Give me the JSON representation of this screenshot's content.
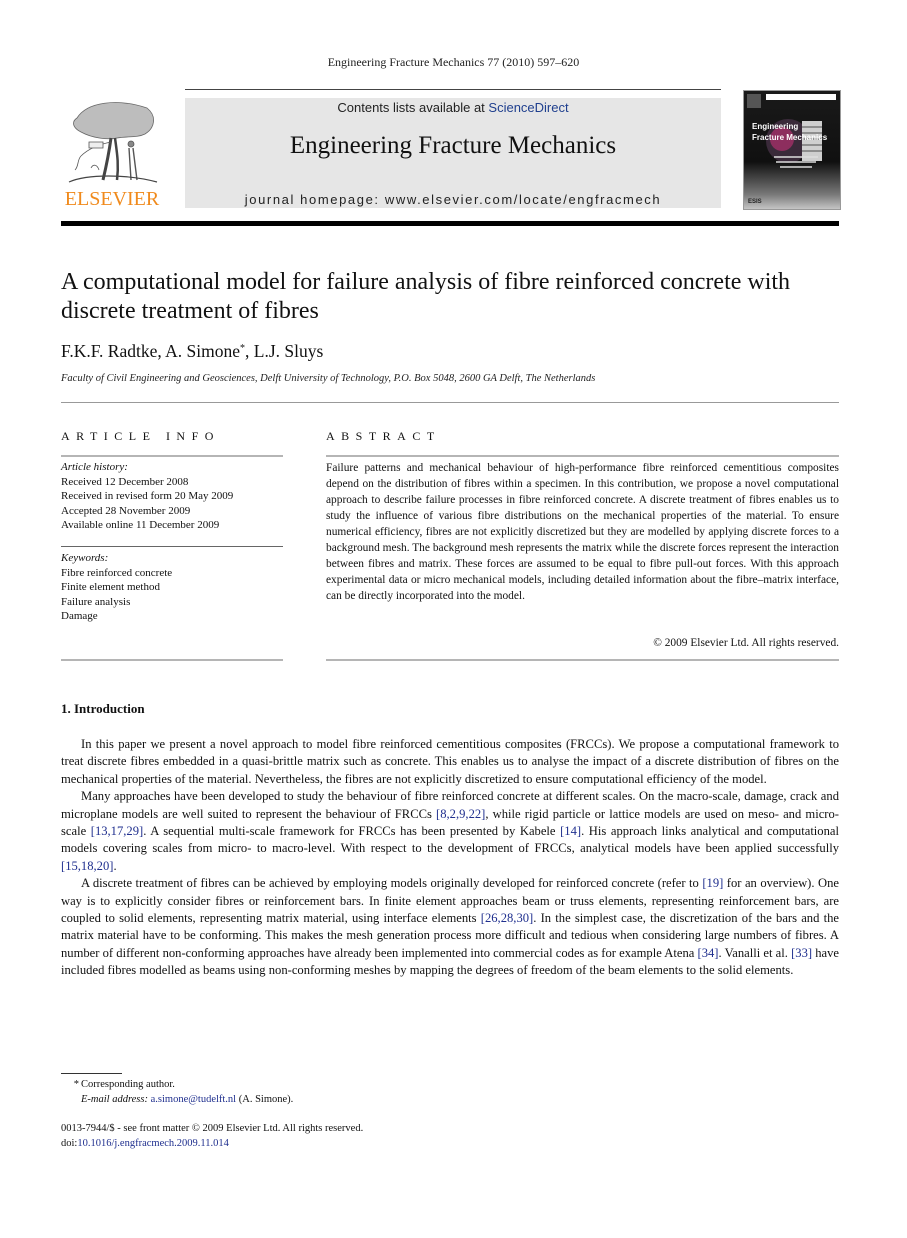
{
  "running_head": "Engineering Fracture Mechanics 77 (2010) 597–620",
  "publisher": {
    "logo_wordmark": "ELSEVIER",
    "brand_color": "#f08a1c"
  },
  "banner": {
    "contents_prefix": "Contents lists available at ",
    "contents_link": "ScienceDirect",
    "journal_title": "Engineering Fracture Mechanics",
    "homepage": "journal homepage: www.elsevier.com/locate/engfracmech",
    "link_color": "#1f3f8e"
  },
  "cover": {
    "title_line1": "Engineering",
    "title_line2": "Fracture Mechanics",
    "footer": "ESIS"
  },
  "article": {
    "title": "A computational model for failure analysis of fibre reinforced concrete with discrete treatment of fibres",
    "authors": [
      {
        "name": "F.K.F. Radtke",
        "mark": ""
      },
      {
        "name": "A. Simone",
        "mark": "*"
      },
      {
        "name": "L.J. Sluys",
        "mark": ""
      }
    ],
    "affiliation": "Faculty of Civil Engineering and Geosciences, Delft University of Technology, P.O. Box 5048, 2600 GA Delft, The Netherlands"
  },
  "article_info": {
    "heading": "ARTICLE INFO",
    "history_label": "Article history:",
    "history": [
      "Received 12 December 2008",
      "Received in revised form 20 May 2009",
      "Accepted 28 November 2009",
      "Available online 11 December 2009"
    ],
    "keywords_label": "Keywords:",
    "keywords": [
      "Fibre reinforced concrete",
      "Finite element method",
      "Failure analysis",
      "Damage"
    ]
  },
  "abstract": {
    "heading": "ABSTRACT",
    "text": "Failure patterns and mechanical behaviour of high-performance fibre reinforced cementitious composites depend on the distribution of fibres within a specimen. In this contribution, we propose a novel computational approach to describe failure processes in fibre reinforced concrete. A discrete treatment of fibres enables us to study the influence of various fibre distributions on the mechanical properties of the material. To ensure numerical efficiency, fibres are not explicitly discretized but they are modelled by applying discrete forces to a background mesh. The background mesh represents the matrix while the discrete forces represent the interaction between fibres and matrix. These forces are assumed to be equal to fibre pull-out forces. With this approach experimental data or micro mechanical models, including detailed information about the fibre–matrix interface, can be directly incorporated into the model.",
    "copyright": "© 2009 Elsevier Ltd. All rights reserved."
  },
  "introduction": {
    "heading": "1.  Introduction",
    "paragraphs": [
      [
        {
          "t": "In this paper we present a novel approach to model fibre reinforced cementitious composites (FRCCs). We propose a computational framework to treat discrete fibres embedded in a quasi-brittle matrix such as concrete. This enables us to analyse the impact of a discrete distribution of fibres on the mechanical properties of the material. Nevertheless, the fibres are not explicitly discretized to ensure computational efficiency of the model."
        }
      ],
      [
        {
          "t": "Many approaches have been developed to study the behaviour of fibre reinforced concrete at different scales. On the macro-scale, damage, crack and microplane models are well suited to represent the behaviour of FRCCs "
        },
        {
          "ref": "[8,2,9,22]"
        },
        {
          "t": ", while rigid particle or lattice models are used on meso- and micro-scale "
        },
        {
          "ref": "[13,17,29]"
        },
        {
          "t": ". A sequential multi-scale framework for FRCCs has been presented by Kabele "
        },
        {
          "ref": "[14]"
        },
        {
          "t": ". His approach links analytical and computational models covering scales from micro- to macro-level. With respect to the development of FRCCs, analytical models have been applied successfully "
        },
        {
          "ref": "[15,18,20]"
        },
        {
          "t": "."
        }
      ],
      [
        {
          "t": "A discrete treatment of fibres can be achieved by employing models originally developed for reinforced concrete (refer to "
        },
        {
          "ref": "[19]"
        },
        {
          "t": " for an overview). One way is to explicitly consider fibres or reinforcement bars. In finite element approaches beam or truss elements, representing reinforcement bars, are coupled to solid elements, representing matrix material, using interface elements "
        },
        {
          "ref": "[26,28,30]"
        },
        {
          "t": ". In the simplest case, the discretization of the bars and the matrix material have to be conforming. This makes the mesh generation process more difficult and tedious when considering large numbers of fibres. A number of different non-conforming approaches have already been implemented into commercial codes as for example Atena "
        },
        {
          "ref": "[34]"
        },
        {
          "t": ". Vanalli et al. "
        },
        {
          "ref": "[33]"
        },
        {
          "t": " have included fibres modelled as beams using non-conforming meshes by mapping the degrees of freedom of the beam elements to the solid elements."
        }
      ]
    ]
  },
  "footnote": {
    "mark": "*",
    "corresponding": "Corresponding author.",
    "email_label": "E-mail address:",
    "email": "a.simone@tudelft.nl",
    "email_suffix": " (A. Simone)."
  },
  "front_matter": {
    "issn_line": "0013-7944/$ - see front matter © 2009 Elsevier Ltd. All rights reserved.",
    "doi_prefix": "doi:",
    "doi": "10.1016/j.engfracmech.2009.11.014"
  }
}
